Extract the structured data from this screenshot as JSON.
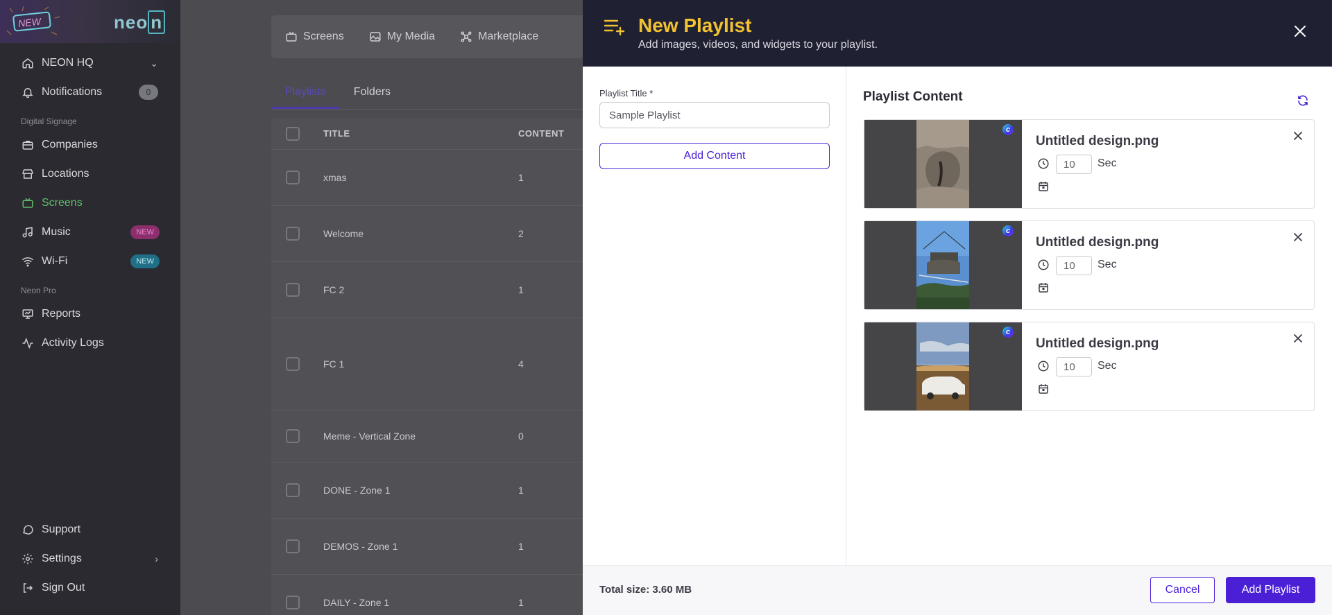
{
  "sidebar": {
    "logo": "neon",
    "workspace": "NEON HQ",
    "notifications": {
      "label": "Notifications",
      "count": "0"
    },
    "section_signage": "Digital Signage",
    "signage_items": [
      {
        "label": "Companies",
        "icon": "briefcase-icon"
      },
      {
        "label": "Locations",
        "icon": "store-icon"
      },
      {
        "label": "Screens",
        "icon": "tv-icon",
        "active": true
      },
      {
        "label": "Music",
        "icon": "music-icon",
        "badge": "NEW"
      },
      {
        "label": "Wi-Fi",
        "icon": "wifi-icon",
        "badge": "NEW"
      }
    ],
    "section_pro": "Neon Pro",
    "pro_items": [
      {
        "label": "Reports",
        "icon": "presentation-icon"
      },
      {
        "label": "Activity Logs",
        "icon": "activity-icon"
      }
    ],
    "bottom_items": [
      {
        "label": "Support",
        "icon": "chat-icon"
      },
      {
        "label": "Settings",
        "icon": "gear-icon"
      },
      {
        "label": "Sign Out",
        "icon": "logout-icon"
      }
    ]
  },
  "background": {
    "tabs": [
      "Screens",
      "My Media",
      "Marketplace"
    ],
    "subtabs": [
      "Playlists",
      "Folders"
    ],
    "table_headers": {
      "title": "TITLE",
      "content": "CONTENT"
    },
    "rows": [
      {
        "title": "xmas",
        "content": "1"
      },
      {
        "title": "Welcome",
        "content": "2"
      },
      {
        "title": "FC 2",
        "content": "1"
      },
      {
        "title": "FC 1",
        "content": "4"
      },
      {
        "title": "Meme - Vertical Zone",
        "content": "0"
      },
      {
        "title": "DONE - Zone 1",
        "content": "1"
      },
      {
        "title": "DEMOS - Zone 1",
        "content": "1"
      },
      {
        "title": "DAILY - Zone 1",
        "content": "1"
      }
    ]
  },
  "panel": {
    "title": "New Playlist",
    "subtitle": "Add images, videos, and widgets to your playlist.",
    "title_label": "Playlist Title",
    "title_required": "*",
    "title_value": "Sample Playlist",
    "add_content": "Add Content",
    "content_heading": "Playlist Content",
    "items": [
      {
        "name": "Untitled design.png",
        "duration": "10",
        "unit": "Sec"
      },
      {
        "name": "Untitled design.png",
        "duration": "10",
        "unit": "Sec"
      },
      {
        "name": "Untitled design.png",
        "duration": "10",
        "unit": "Sec"
      }
    ],
    "total_size": "Total size: 3.60 MB",
    "cancel": "Cancel",
    "submit": "Add Playlist"
  },
  "colors": {
    "accent": "#4a1fd6",
    "title_yellow": "#f2c230",
    "header_bg": "#1f2133",
    "active_green": "#5fbf6a"
  }
}
